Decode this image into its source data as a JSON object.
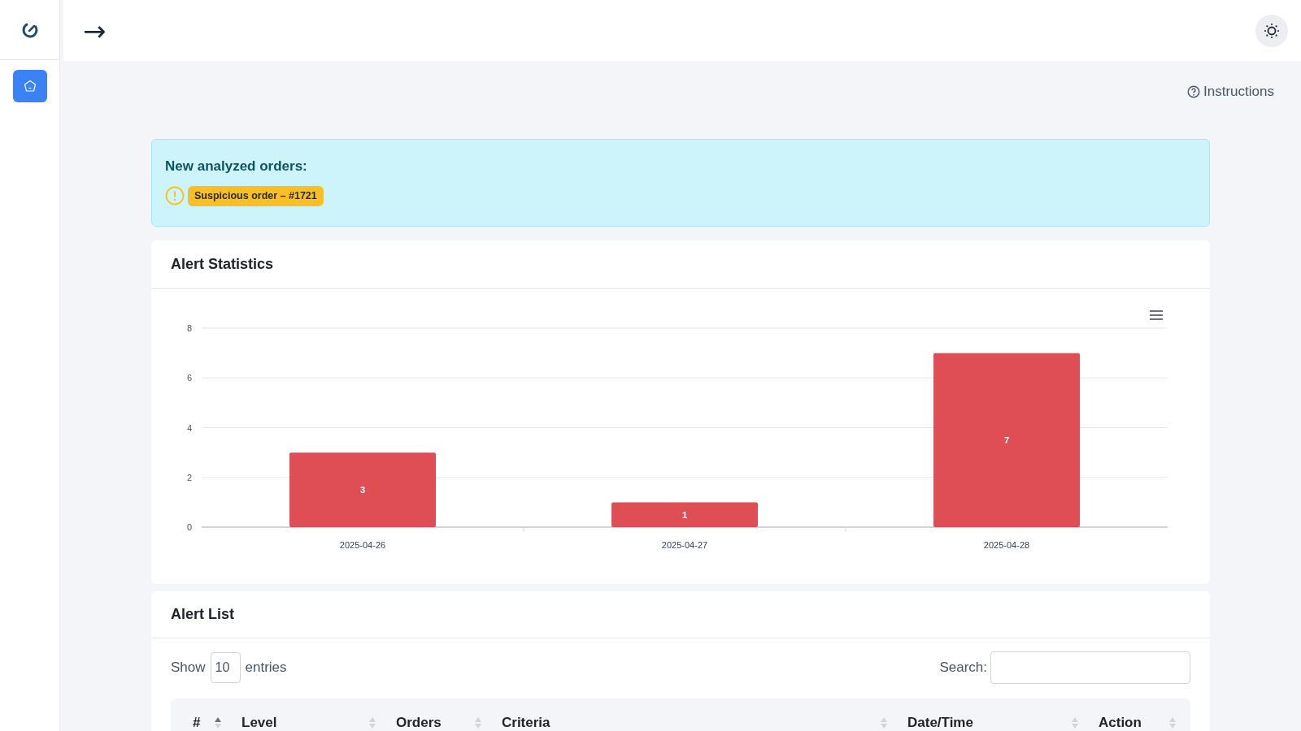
{
  "topbar": {
    "nav_arrow": "→"
  },
  "sidebar": {
    "items": [
      {
        "kind": "home",
        "selected": true
      }
    ]
  },
  "instructions": "Instructions",
  "banner": {
    "title": "New analyzed orders:",
    "alerts": [
      {
        "label": "Suspicious order – #1721",
        "color": "#fbbf24"
      }
    ]
  },
  "statistics": {
    "title": "Alert Statistics",
    "chart_data": {
      "type": "bar",
      "categories": [
        "2025-04-26",
        "2025-04-27",
        "2025-04-28"
      ],
      "series": [
        {
          "color": "#dc3f45",
          "values": [
            3,
            1,
            7
          ]
        }
      ],
      "ylim": [
        0,
        8
      ],
      "yticks": [
        0,
        2,
        4,
        6,
        8
      ],
      "grid": true,
      "data_labels": true
    }
  },
  "alert_list": {
    "title": "Alert List",
    "show_label": "Show",
    "page_size": "10",
    "entries_label": "entries",
    "search_label": "Search:",
    "columns": [
      {
        "label": "#",
        "sorted_ascending": true
      },
      {
        "label": "Level",
        "sorted_ascending": false
      },
      {
        "label": "Orders",
        "sorted_ascending": false
      },
      {
        "label": "Criteria",
        "sorted_ascending": false
      },
      {
        "label": "Date/Time",
        "sorted_ascending": false
      },
      {
        "label": "Action",
        "sorted_ascending": false
      }
    ]
  }
}
